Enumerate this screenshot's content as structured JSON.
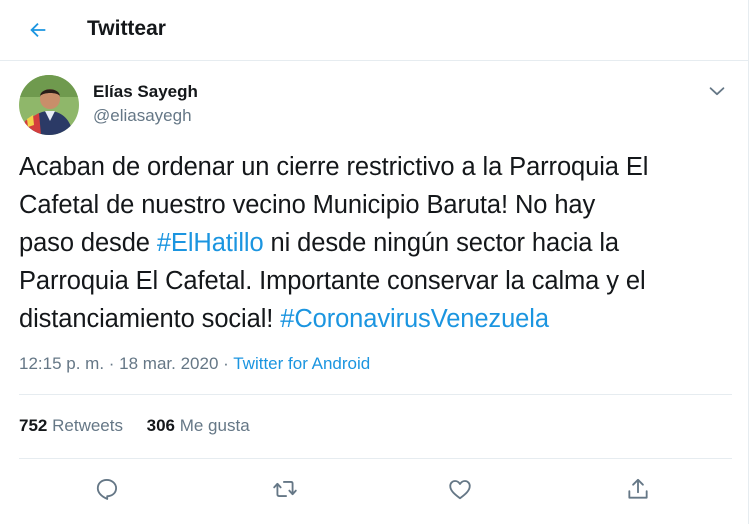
{
  "header": {
    "title": "Twittear",
    "back_icon": "arrow-left-icon"
  },
  "author": {
    "name": "Elías Sayegh",
    "handle": "@eliasayegh"
  },
  "tweet": {
    "lines": [
      [
        "Acaban de ordenar un cierre restrictivo a la Parroquia El"
      ],
      [
        "Cafetal de nuestro vecino Municipio Baruta! No hay"
      ],
      [
        "paso desde ",
        "#ElHatillo",
        " ni desde ningún sector hacia la"
      ],
      [
        "Parroquia El Cafetal. Importante conservar la calma y el"
      ],
      [
        "distanciamiento social! ",
        "#CoronavirusVenezuela"
      ]
    ]
  },
  "meta": {
    "time": "12:15 p. m.",
    "dot1": " · ",
    "date": "18 mar. 2020",
    "dot2": " · ",
    "source": "Twitter for Android"
  },
  "stats": {
    "retweets_count": "752",
    "retweets_label": "Retweets",
    "likes_count": "306",
    "likes_label": "Me gusta"
  },
  "colors": {
    "accent": "#1b95e0",
    "secondary_text": "#657786",
    "border": "#e6ecf0"
  }
}
